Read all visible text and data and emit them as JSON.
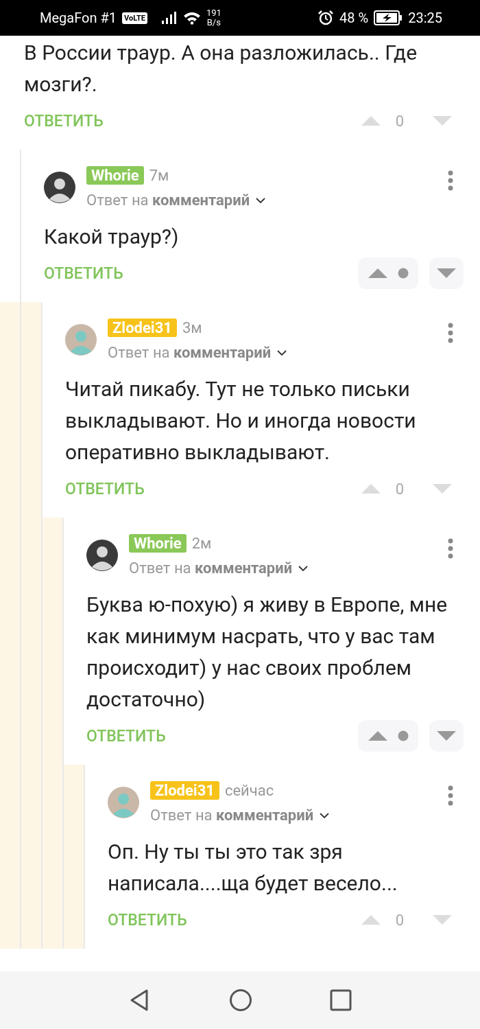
{
  "status_bar": {
    "carrier": "MegaFon #1",
    "network_badge": "VoLTE",
    "speed_value": "191",
    "speed_unit": "B/s",
    "battery": "48 %",
    "time": "23:25"
  },
  "comments": [
    {
      "text": "В России траур. А она разложилась.. Где мозги?.",
      "reply_label": "ОТВЕТИТЬ",
      "rating": "0",
      "own": false,
      "children": [
        {
          "author": "Whorie",
          "color": "#8ac858",
          "time": "7м",
          "reply_to": "Ответ на **комментарий**",
          "text": "Какой траур?)",
          "reply_label": "ОТВЕТИТЬ",
          "own": true,
          "children": [
            {
              "author": "Zlodei31",
              "color": "#f7c31a",
              "time": "3м",
              "reply_to": "Ответ на **комментарий**",
              "text": "Читай пикабу. Тут не только письки выкладывают. Но и иногда новости оперативно выкладывают.",
              "reply_label": "ОТВЕТИТЬ",
              "rating": "0",
              "own": false,
              "children": [
                {
                  "author": "Whorie",
                  "color": "#8ac858",
                  "time": "2м",
                  "reply_to": "Ответ на **комментарий**",
                  "text": "Буква ю-похую) я живу в Европе, мне как минимум насрать, что у вас там происходит) у нас своих проблем достаточно)",
                  "reply_label": "ОТВЕТИТЬ",
                  "own": true,
                  "children": [
                    {
                      "author": "Zlodei31",
                      "color": "#f7c31a",
                      "time": "сейчас",
                      "reply_to": "Ответ на **комментарий**",
                      "text": "Оп. Ну ты ты это так зря написала....ща будет весело...",
                      "reply_label": "ОТВЕТИТЬ",
                      "rating": "0",
                      "own": false
                    }
                  ]
                }
              ]
            }
          ]
        }
      ]
    }
  ]
}
